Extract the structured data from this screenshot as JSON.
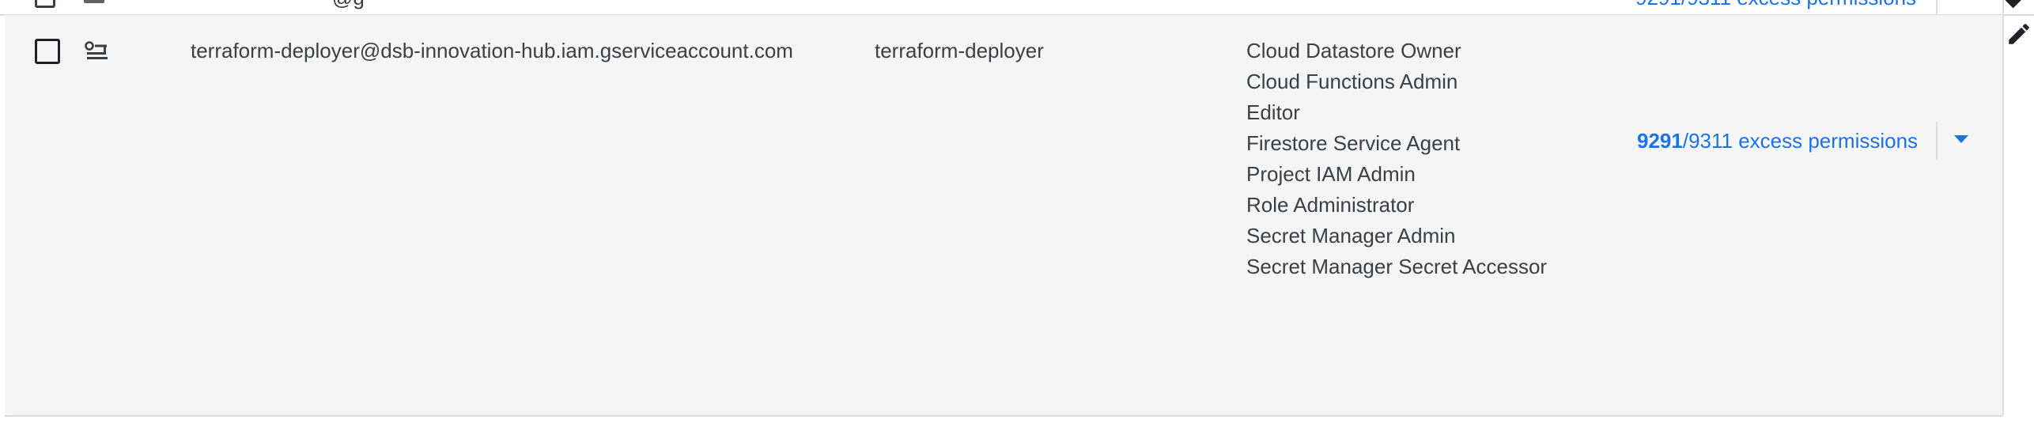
{
  "previous_row": {
    "email_partial": "@g",
    "permissions_partial": "9291/9311 excess permissions"
  },
  "row": {
    "email": "terraform-deployer@dsb-innovation-hub.iam.gserviceaccount.com",
    "name": "terraform-deployer",
    "roles": [
      "Cloud Datastore Owner",
      "Cloud Functions Admin",
      "Editor",
      "Firestore Service Agent",
      "Project IAM Admin",
      "Role Administrator",
      "Secret Manager Admin",
      "Secret Manager Secret Accessor"
    ],
    "permissions": {
      "excess": "9291",
      "rest": "/9311 excess permissions"
    }
  },
  "icons": {
    "account": "service-account-icon",
    "dropdown": "arrow-drop-down-icon",
    "edit": "edit-pencil-icon"
  },
  "colors": {
    "link": "#1a73e8",
    "row_bg": "#f5f5f5",
    "divider": "#dadce0"
  }
}
